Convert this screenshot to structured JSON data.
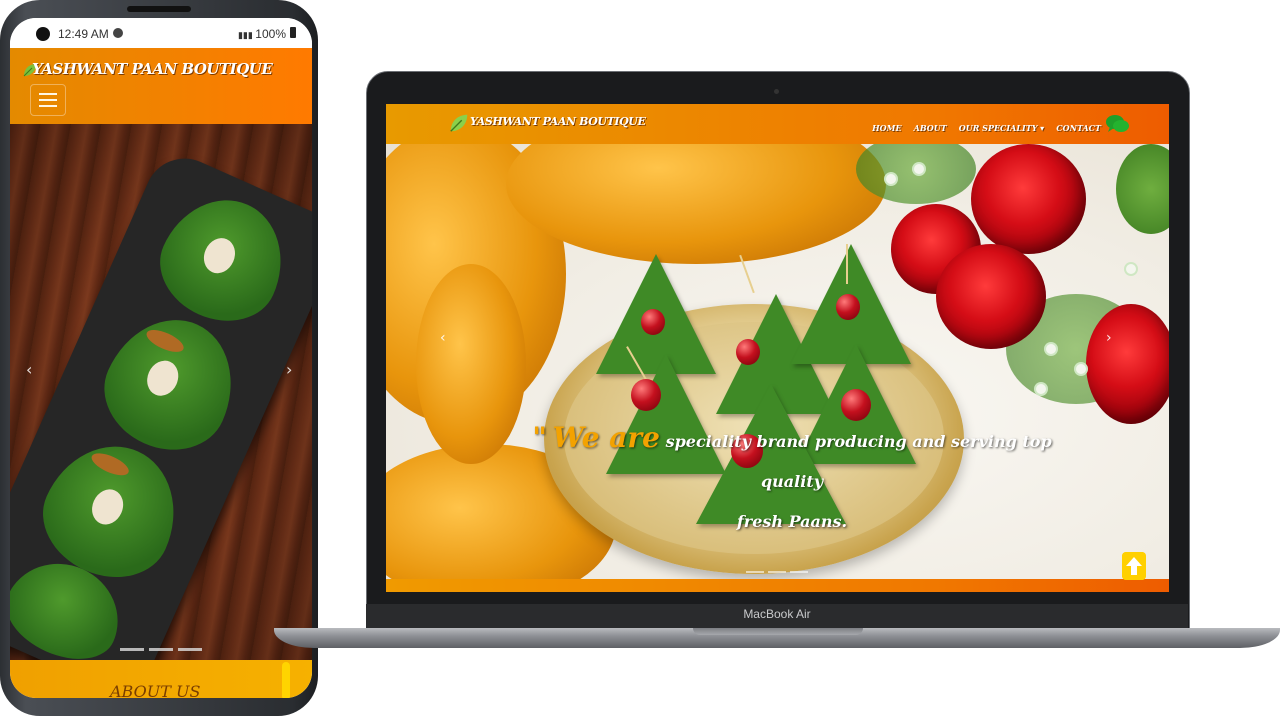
{
  "phone": {
    "status": {
      "time": "12:49 AM",
      "battery": "100%"
    },
    "brand": "YASHWANT PAAN BOUTIQUE",
    "icons": {
      "menu": "hamburger-icon",
      "prev": "chevron-left-icon",
      "next": "chevron-right-icon",
      "leaf": "leaf-icon"
    },
    "carousel": {
      "prev_symbol": "‹",
      "next_symbol": "›",
      "indicator_count": 3
    },
    "about_title": "ABOUT US"
  },
  "laptop": {
    "model": "MacBook Air",
    "site": {
      "brand": "YASHWANT PAAN BOUTIQUE",
      "nav": {
        "home": "HOME",
        "about": "ABOUT",
        "speciality": "OUR SPECIALITY ▾",
        "contact": "CONTACT"
      },
      "icons": {
        "chat": "chat-bubbles-icon",
        "scroll_top": "arrow-up-icon",
        "prev": "chevron-left-icon",
        "next": "chevron-right-icon"
      },
      "hero": {
        "quote_open": "\"",
        "quote_accent": "We are",
        "quote_line1": "speciality brand producing and serving top quality",
        "quote_line2": "fresh Paans.",
        "prev_symbol": "‹",
        "next_symbol": "›"
      }
    }
  },
  "colors": {
    "header_start": "#e89a00",
    "header_end": "#ee5c00",
    "accent_text": "#f3a200",
    "scroll_top": "#ffd000"
  }
}
